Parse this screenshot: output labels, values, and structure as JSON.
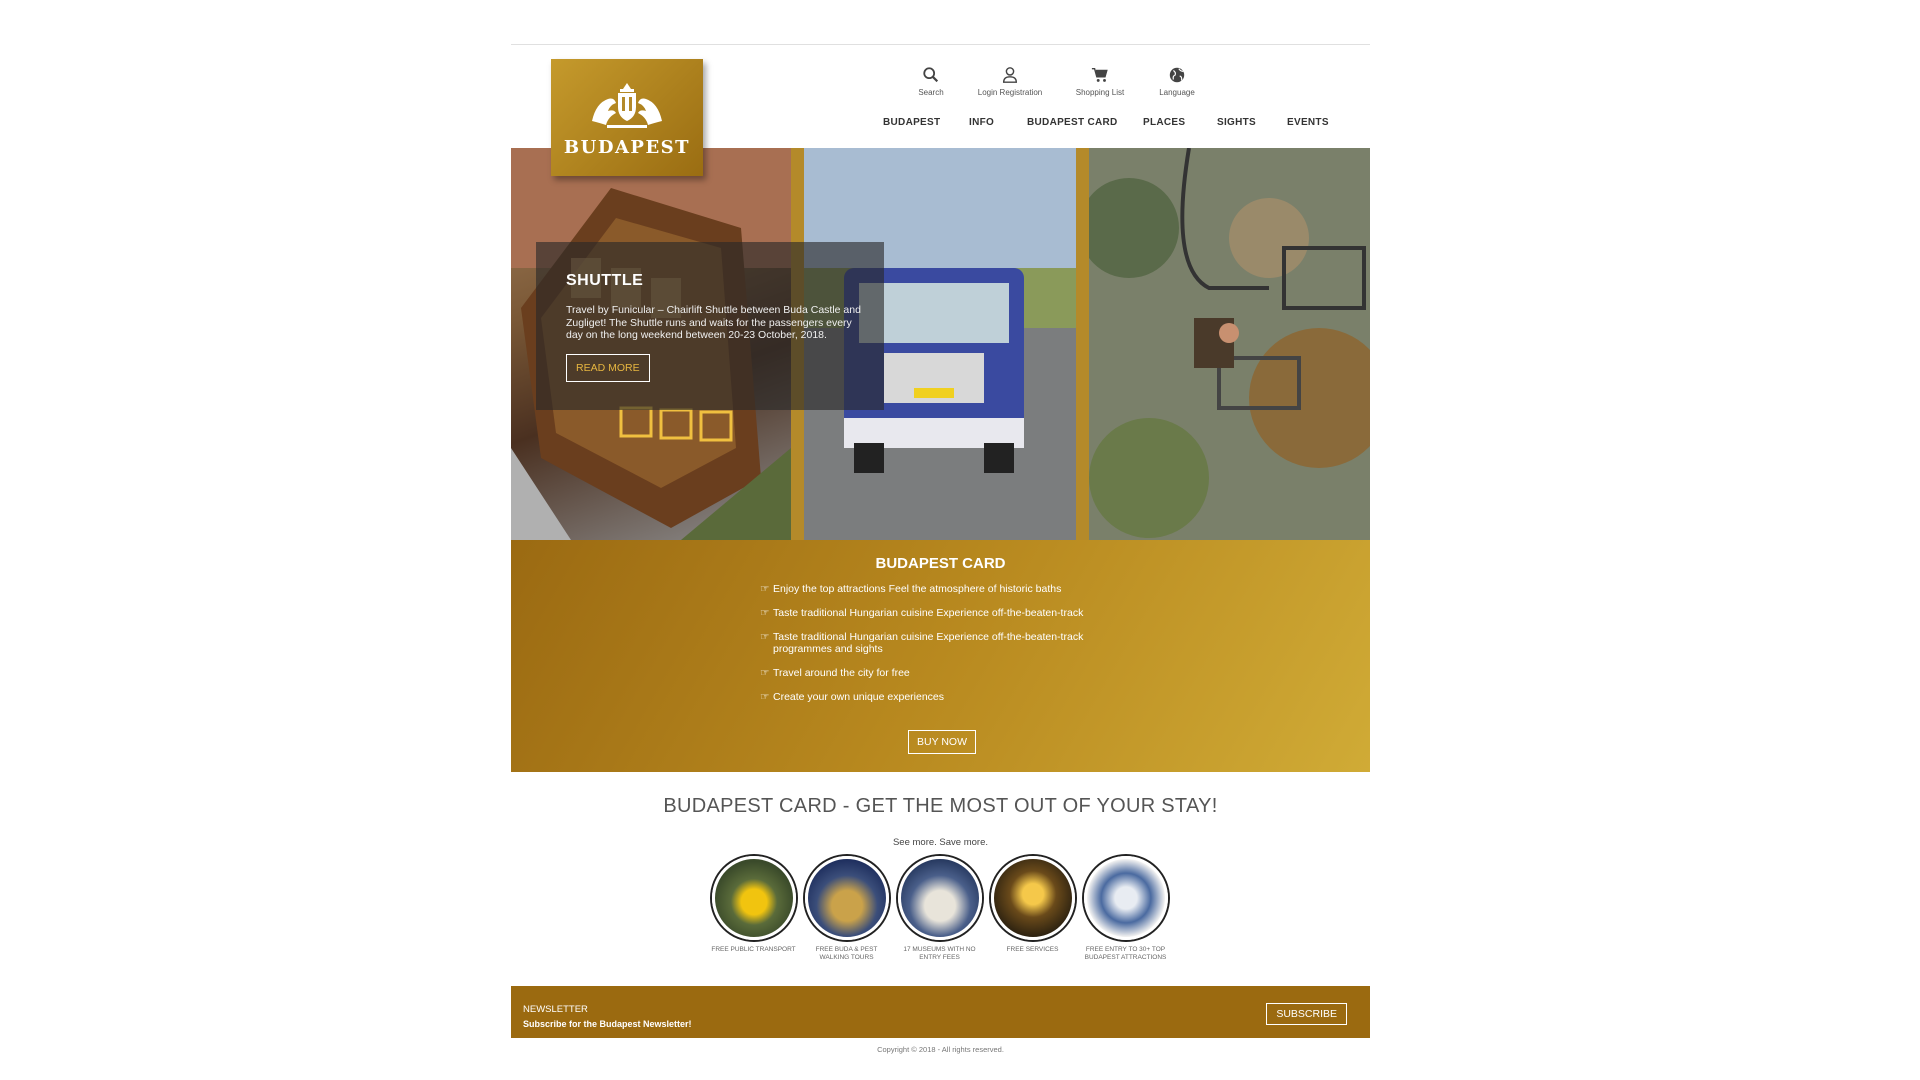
{
  "header": {
    "logo_text": "BUDAPEST",
    "utilities": [
      {
        "label": "Search",
        "icon": "search-icon"
      },
      {
        "label": "Login Registration",
        "icon": "user-icon"
      },
      {
        "label": "Shopping List",
        "icon": "cart-icon"
      },
      {
        "label": "Language",
        "icon": "globe-icon"
      }
    ],
    "nav": [
      "BUDAPEST",
      "INFO",
      "BUDAPEST CARD",
      "PLACES",
      "SIGHTS",
      "EVENTS"
    ]
  },
  "hero": {
    "title": "SHUTTLE",
    "text": "Travel by Funicular – Chairlift Shuttle between Buda Castle and Zugliget! The Shuttle runs and waits for the passengers every day on the long weekend between 20-23 October, 2018.",
    "button": "READ MORE"
  },
  "card": {
    "title": "BUDAPEST CARD",
    "items": [
      "Enjoy the top attractions Feel the atmosphere of historic baths",
      "Taste traditional Hungarian cuisine Experience off-the-beaten-track",
      "Taste traditional Hungarian cuisine Experience off-the-beaten-track programmes and sights",
      "Travel around the city for free",
      "Create your own unique experiences"
    ],
    "button": "BUY NOW"
  },
  "promo": {
    "headline": "BUDAPEST CARD - GET THE MOST OUT OF YOUR STAY!",
    "tagline": "See more. Save more.",
    "benefits": [
      "FREE PUBLIC TRANSPORT",
      "FREE BUDA & PEST WALKING TOURS",
      "17 MUSEUMS WITH NO ENTRY FEES",
      "FREE SERVICES",
      "FREE ENTRY TO 30+ TOP BUDAPEST ATTRACTIONS"
    ]
  },
  "newsletter": {
    "title": "NEWSLETTER",
    "subtitle": "Subscribe for the Budapest Newsletter!",
    "button": "SUBSCRIBE"
  },
  "footer": {
    "copyright": "Copyright © 2018 - All rights reserved."
  },
  "colors": {
    "gold": "#b8891f",
    "gold_dark": "#9b6a10",
    "gold_light": "#d0ab36"
  }
}
